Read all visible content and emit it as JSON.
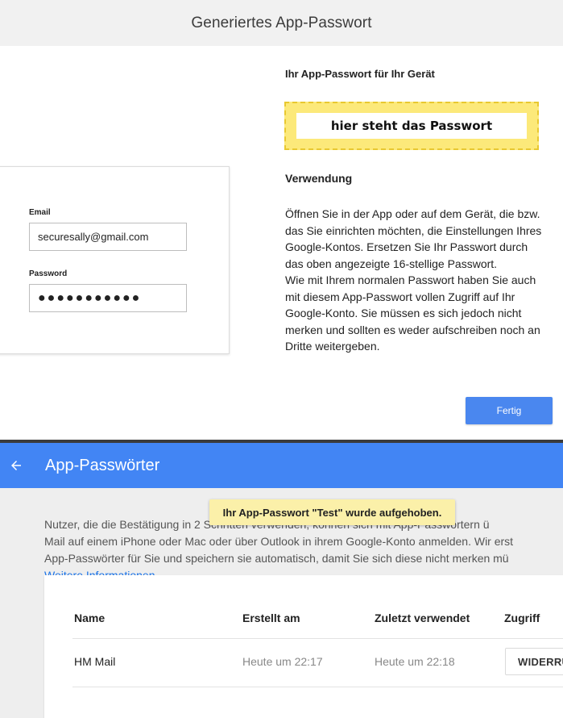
{
  "dialog": {
    "title": "Generiertes App-Passwort",
    "login": {
      "email_label": "Email",
      "email_value": "securesally@gmail.com",
      "password_label": "Password",
      "password_value": "●●●●●●●●●●●"
    },
    "password_heading": "Ihr App-Passwort für Ihr Gerät",
    "password_value": "hier steht das Passwort",
    "usage_heading": "Verwendung",
    "usage_text": "Öffnen Sie in der App oder auf dem Gerät, die bzw. das Sie einrichten möchten, die Einstellungen Ihres Google-Kontos. Ersetzen Sie Ihr Passwort durch das oben angezeigte 16-stellige Passwort.",
    "usage_text_2": "Wie mit Ihrem normalen Passwort haben Sie auch mit diesem App-Passwort vollen Zugriff auf Ihr Google-Konto. Sie müssen es sich jedoch nicht merken und sollten es weder aufschreiben noch an Dritte weitergeben.",
    "done_label": "Fertig"
  },
  "page": {
    "title": "App-Passwörter",
    "toast": "Ihr App-Passwort \"Test\" wurde aufgehoben.",
    "desc_line1": "Nutzer, die die Bestätigung in 2 Schritten verwenden, können sich mit App-Passwörtern ü",
    "desc_line2": "Mail auf einem iPhone oder Mac oder über Outlook in ihrem Google-Konto anmelden. Wir erst",
    "desc_line3": "App-Passwörter für Sie und speichern sie automatisch, damit Sie sich diese nicht merken mü",
    "more_info": "Weitere Informationen",
    "table": {
      "headers": [
        "Name",
        "Erstellt am",
        "Zuletzt verwendet",
        "Zugriff"
      ],
      "rows": [
        {
          "name": "HM Mail",
          "created": "Heute um 22:17",
          "last_used": "Heute um 22:18",
          "action": "WIDERRUFEN"
        }
      ]
    }
  }
}
